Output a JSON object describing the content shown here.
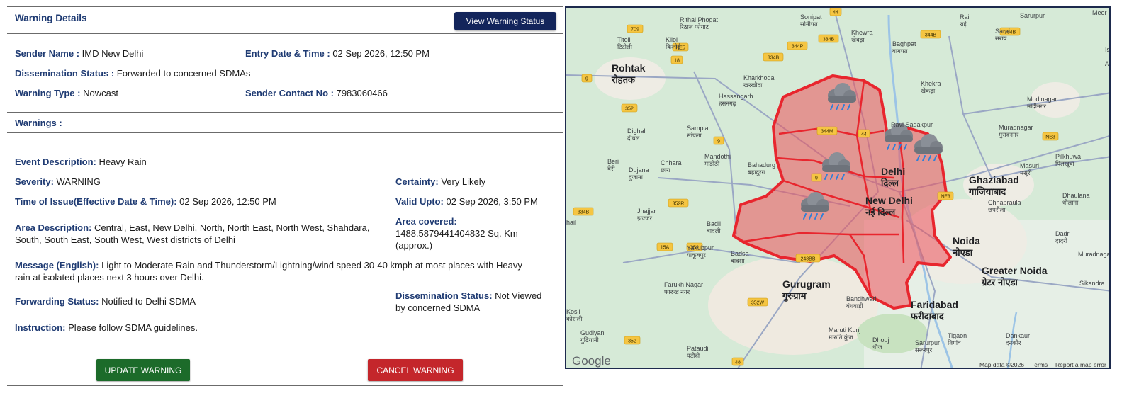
{
  "header": {
    "title": "Warning Details",
    "view_button": "View Warning Status"
  },
  "summary": {
    "sender_name_label": "Sender Name :",
    "sender_name": "IMD New Delhi",
    "entry_label": "Entry Date & Time :",
    "entry_value": "02 Sep 2026, 12:50 PM",
    "dissemination_label": "Dissemination Status :",
    "dissemination_value": "Forwarded to concerned SDMAs",
    "type_label": "Warning Type :",
    "type_value": "Nowcast",
    "contact_label": "Sender Contact No :",
    "contact_value": "7983060466"
  },
  "warnings": {
    "title": "Warnings :",
    "event_label": "Event Description:",
    "event_value": "Heavy Rain",
    "severity_label": "Severity:",
    "severity_value": "WARNING",
    "certainty_label": "Certainty:",
    "certainty_value": "Very Likely",
    "issue_label": "Time of Issue(Effective Date & Time):",
    "issue_value": "02 Sep 2026, 12:50 PM",
    "valid_label": "Valid Upto:",
    "valid_value": "02 Sep 2026, 3:50 PM",
    "area_desc_label": "Area Description:",
    "area_desc_value": "Central, East, New Delhi, North, North East, North West, Shahdara,",
    "area_desc_value2": "South, South East, South West, West districts of Delhi",
    "area_cov_label": "Area covered:",
    "area_cov_value": "1488.5879441404832 Sq. Km",
    "area_cov_value2": "(approx.)",
    "message_label": "Message (English):",
    "message_value": "Light to Moderate Rain and Thunderstorm/Lightning/wind speed 30-40 kmph at most places with Heavy",
    "message_value2": "rain at isolated places next 3 hours over Delhi.",
    "forwarding_label": "Forwarding Status:",
    "forwarding_value": "Notified to Delhi SDMA",
    "dissem2_label": "Dissemination Status:",
    "dissem2_value": "Not Viewed",
    "dissem2_value2": "by concerned SDMA",
    "instruction_label": "Instruction:",
    "instruction_value": "Please follow SDMA guidelines."
  },
  "actions": {
    "update": "UPDATE WARNING",
    "cancel": "CANCEL WARNING"
  },
  "map": {
    "places": [
      {
        "en": "Rithal Phogat",
        "hi": "रिठाल फोगाट"
      },
      {
        "en": "Sonipat",
        "hi": "सोनीपत"
      },
      {
        "en": "Titoli",
        "hi": "टिटोली"
      },
      {
        "en": "Kiloi",
        "hi": "किलोई"
      },
      {
        "en": "Khewra",
        "hi": "खेवड़ा"
      },
      {
        "en": "Rai",
        "hi": "राई"
      },
      {
        "en": "Baghpat",
        "hi": "बागपत"
      },
      {
        "en": "Sarai",
        "hi": "सराय"
      },
      {
        "en": "Sarurpur",
        "hi": ""
      },
      {
        "en": "Rohtak",
        "hi": "रोहतक"
      },
      {
        "en": "Kharkhoda",
        "hi": "खरखौदा"
      },
      {
        "en": "Khekra",
        "hi": "खेकड़ा"
      },
      {
        "en": "Hassangarh",
        "hi": "हसनगढ़"
      },
      {
        "en": "Dighal",
        "hi": "दीघल"
      },
      {
        "en": "Sampla",
        "hi": "सांपला"
      },
      {
        "en": "Ravi Sadakpur",
        "hi": ""
      },
      {
        "en": "Muradnagar",
        "hi": "मुरादनगर"
      },
      {
        "en": "Modinagar",
        "hi": "मोदीनगर"
      },
      {
        "en": "Beri",
        "hi": "बेरी"
      },
      {
        "en": "Dujana",
        "hi": "दुजाना"
      },
      {
        "en": "Chhara",
        "hi": "छारा"
      },
      {
        "en": "Mandothi",
        "hi": "मांडोठी"
      },
      {
        "en": "Bahadurg",
        "hi": "बहादुरग"
      },
      {
        "en": "Delhi",
        "hi": "दिल्ल"
      },
      {
        "en": "Ghaziabad",
        "hi": "गाजियाबाद"
      },
      {
        "en": "Masuri",
        "hi": "मसूरी"
      },
      {
        "en": "Pilkhuwa",
        "hi": "पिलखुवा"
      },
      {
        "en": "Jhajjar",
        "hi": "झज्जर"
      },
      {
        "en": "New Delhi",
        "hi": "नई दिल्ल"
      },
      {
        "en": "Chhapraula",
        "hi": "छपरौला"
      },
      {
        "en": "Dhaulana",
        "hi": "धौलाना"
      },
      {
        "en": "Badli",
        "hi": "बादली"
      },
      {
        "en": "Dadri",
        "hi": "दादरी"
      },
      {
        "en": "Noida",
        "hi": "नोएडा"
      },
      {
        "en": "Yakubpur",
        "hi": "याकूबपुर"
      },
      {
        "en": "Farukh Nagar",
        "hi": "फारुख नगर"
      },
      {
        "en": "Gurugram",
        "hi": "गुरुग्राम"
      },
      {
        "en": "Greater Noida",
        "hi": "ग्रेटर नोएडा"
      },
      {
        "en": "Muradnagar",
        "hi": ""
      },
      {
        "en": "Sikandra",
        "hi": ""
      },
      {
        "en": "Faridabad",
        "hi": "फरीदाबाद"
      },
      {
        "en": "Bandhwari",
        "hi": "बंधवाड़ी"
      },
      {
        "en": "Kosli",
        "hi": "कोसली"
      },
      {
        "en": "Gudiyani",
        "hi": "गुढियानी"
      },
      {
        "en": "Maruti Kunj",
        "hi": "मारुति कुंज"
      },
      {
        "en": "Tigaon",
        "hi": "तिगांव"
      },
      {
        "en": "Dankaur",
        "hi": "दनकौर"
      },
      {
        "en": "Pataudi",
        "hi": "पटौदी"
      },
      {
        "en": "Dhouj",
        "hi": "धौज"
      },
      {
        "en": "Sarurpur",
        "hi": "सरूरपुर"
      },
      {
        "en": "Badsa",
        "hi": "बादसा"
      },
      {
        "en": "hail",
        "hi": ""
      },
      {
        "en": "Meer",
        "hi": ""
      },
      {
        "en": "Ishaqpur",
        "hi": ""
      },
      {
        "en": "Atmanpur",
        "hi": ""
      }
    ],
    "road_shields": [
      "44",
      "709",
      "NE5",
      "18",
      "9",
      "352",
      "9",
      "334B",
      "344P",
      "334B",
      "344B",
      "334B",
      "9",
      "44",
      "344M",
      "NE3",
      "NE3",
      "334B",
      "352R",
      "352",
      "15A",
      "248BB",
      "352",
      "352W",
      "48"
    ],
    "footer_brand": "Google",
    "footer_links": [
      "Map data ©2026",
      "Terms",
      "Report a map error"
    ],
    "warning_icons": 5
  }
}
